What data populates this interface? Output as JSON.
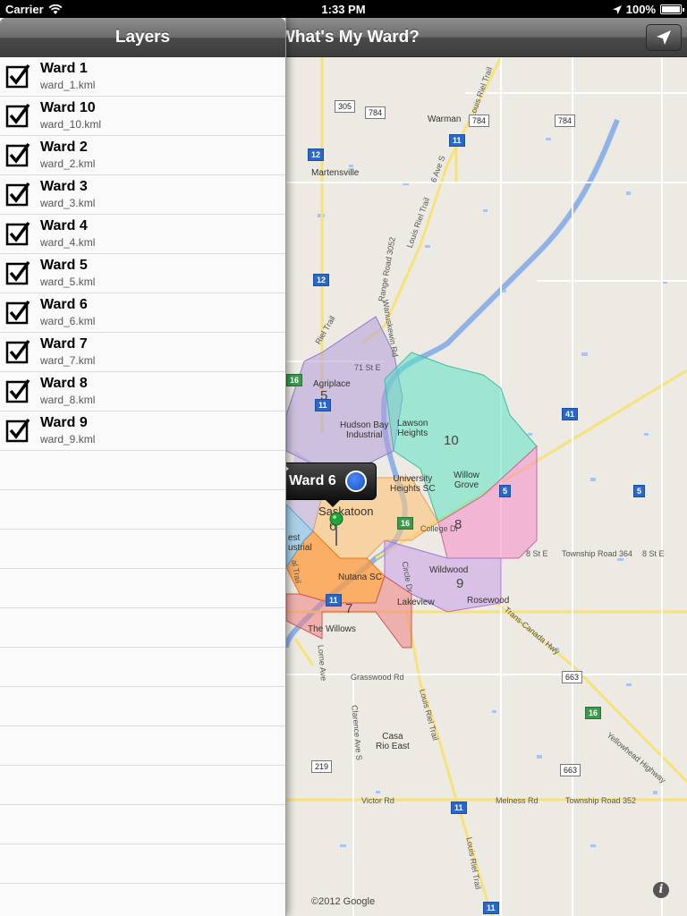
{
  "status_bar": {
    "carrier": "Carrier",
    "time": "1:33 PM",
    "battery": "100%"
  },
  "navbar": {
    "title": "What's My Ward?",
    "location_icon": "location-arrow-icon"
  },
  "layers_panel": {
    "title": "Layers",
    "items": [
      {
        "name": "Ward 1",
        "file": "ward_1.kml",
        "checked": true
      },
      {
        "name": "Ward 10",
        "file": "ward_10.kml",
        "checked": true
      },
      {
        "name": "Ward 2",
        "file": "ward_2.kml",
        "checked": true
      },
      {
        "name": "Ward 3",
        "file": "ward_3.kml",
        "checked": true
      },
      {
        "name": "Ward 4",
        "file": "ward_4.kml",
        "checked": true
      },
      {
        "name": "Ward 5",
        "file": "ward_5.kml",
        "checked": true
      },
      {
        "name": "Ward 6",
        "file": "ward_6.kml",
        "checked": true
      },
      {
        "name": "Ward 7",
        "file": "ward_7.kml",
        "checked": true
      },
      {
        "name": "Ward 8",
        "file": "ward_8.kml",
        "checked": true
      },
      {
        "name": "Ward 9",
        "file": "ward_9.kml",
        "checked": true
      }
    ]
  },
  "map": {
    "callout_title": "Ward 6",
    "copyright": "©2012 Google",
    "places": {
      "warman": "Warman",
      "martensville": "Martensville",
      "agriplace": "Agriplace",
      "hudson_bay": "Hudson Bay\nIndustrial",
      "lawson": "Lawson\nHeights",
      "university": "University\nHeights SC",
      "willow_grove": "Willow\nGrove",
      "saskatoon": "Saskatoon",
      "west": "est\nustrial",
      "nutana": "Nutana SC",
      "wildwood": "Wildwood",
      "rosewood": "Rosewood",
      "lakeview": "Lakeview",
      "willows": "The Willows",
      "casa": "Casa\nRio East"
    },
    "roads": {
      "louis_riel_top": "Louis Riel Trail",
      "ave_s": "6 Ave S",
      "range_road": "Range Road 3052",
      "louis_riel_mid": "Louis Riel Trail",
      "wanuskewin": "Wanuskewin Rd",
      "st71": "71 St E",
      "college": "College Dr",
      "st8": "8 St E",
      "st8b": "8 St E",
      "township364": "Township Road 364",
      "circle": "Circle Dr",
      "trans_canada": "Trans-Canada Hwy",
      "grasswood": "Grasswood Rd",
      "louis_riel_bottom": "Louis Riel Trail",
      "clarence": "Clarence Ave S",
      "lorne": "Lorne Ave",
      "yellowhead": "Yellowhead Highway",
      "victor": "Victor Rd",
      "melness": "Melness Rd",
      "township352": "Township Road 352",
      "louis_riel_low": "Louis Riel Trail",
      "riel_trail": "Riel Trail",
      "trail": "al Trail"
    },
    "shields": {
      "h305": "305",
      "h784a": "784",
      "h784b": "784",
      "h784c": "784",
      "h11a": "11",
      "h12a": "12",
      "h12b": "12",
      "h16a": "16",
      "h11b": "11",
      "h41": "41",
      "h5a": "5",
      "h5b": "5",
      "h16b": "16",
      "h11c": "11",
      "h219": "219",
      "h663a": "663",
      "h663b": "663",
      "h16c": "16",
      "h11d": "11",
      "h11e": "11"
    },
    "wards": {
      "w5": "5",
      "w10": "10",
      "w6": "6",
      "w8": "8",
      "w9": "9",
      "w7": "7"
    }
  }
}
